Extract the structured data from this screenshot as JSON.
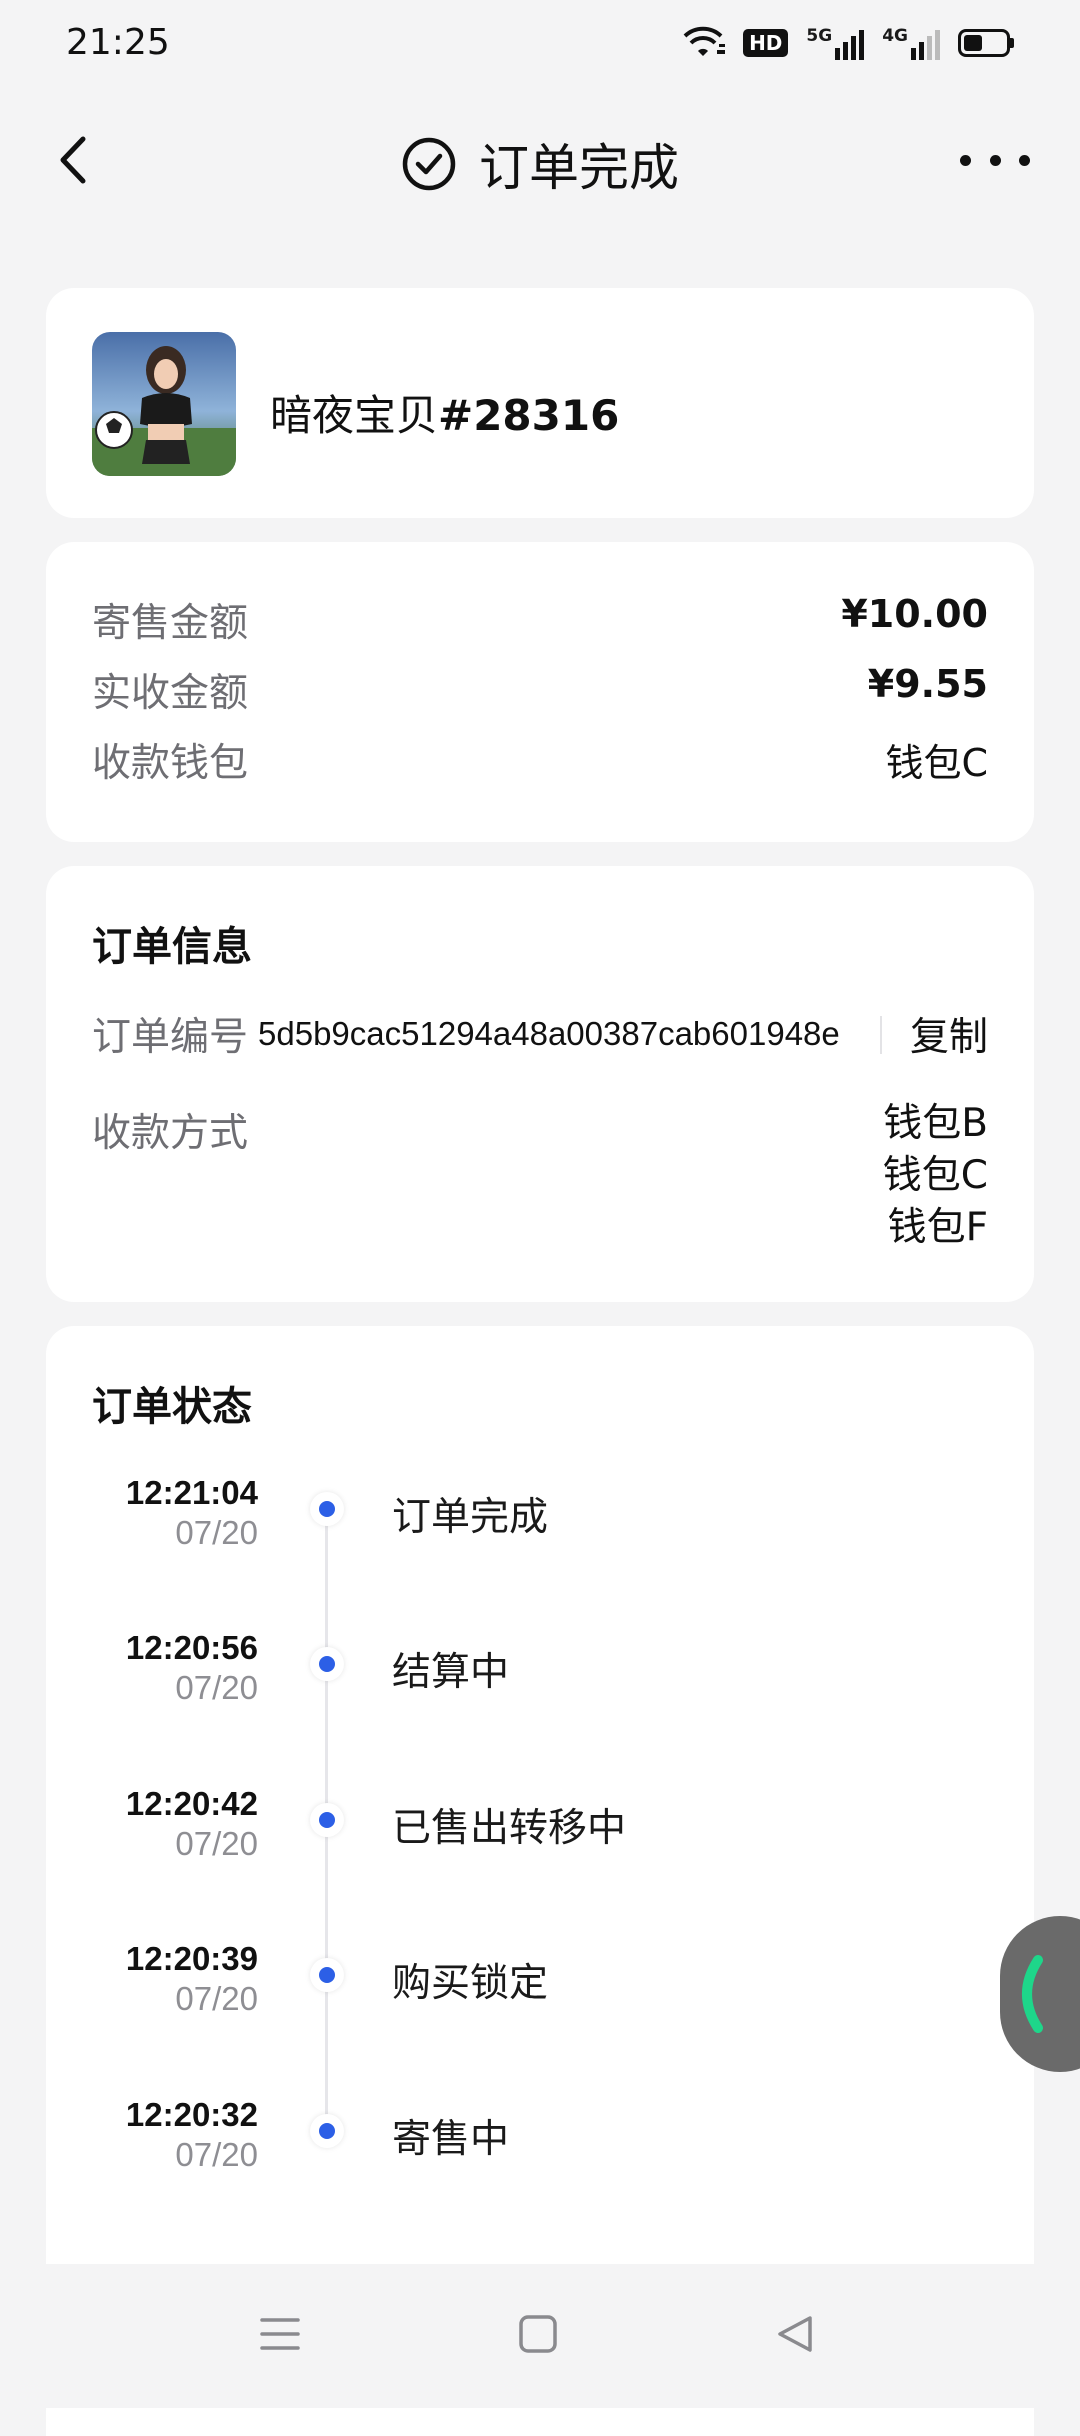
{
  "status_bar": {
    "time": "21:25",
    "hd_label": "HD",
    "sim1_label": "5G",
    "sim2_label": "4G",
    "battery_level": 0.45
  },
  "nav": {
    "back_icon": "chevron-left-icon",
    "status_icon": "check-circle-icon",
    "title": "订单完成",
    "more_icon": "more-horizontal-icon"
  },
  "product": {
    "name_prefix": "暗夜宝贝",
    "name_number": "#28316",
    "thumb_icon": "product-thumbnail"
  },
  "amounts": [
    {
      "label": "寄售金额",
      "value": "¥10.00"
    },
    {
      "label": "实收金额",
      "value": "¥9.55"
    },
    {
      "label": "收款钱包",
      "value": "钱包C"
    }
  ],
  "order_info": {
    "title": "订单信息",
    "id_label": "订单编号",
    "id_value": "5d5b9cac51294a48a00387cab601948e",
    "copy_label": "复制",
    "method_label": "收款方式",
    "methods": [
      "钱包B",
      "钱包C",
      "钱包F"
    ]
  },
  "order_status": {
    "title": "订单状态",
    "items": [
      {
        "time": "12:21:04",
        "date": "07/20",
        "label": "订单完成"
      },
      {
        "time": "12:20:56",
        "date": "07/20",
        "label": "结算中"
      },
      {
        "time": "12:20:42",
        "date": "07/20",
        "label": "已售出转移中"
      },
      {
        "time": "12:20:39",
        "date": "07/20",
        "label": "购买锁定"
      },
      {
        "time": "12:20:32",
        "date": "07/20",
        "label": "寄售中"
      }
    ]
  },
  "colors": {
    "accent_dot": "#2c5fe6",
    "page_bg": "#f4f4f5",
    "card_bg": "#ffffff"
  },
  "system_nav": {
    "menu_icon": "menu-icon",
    "home_icon": "home-square-icon",
    "back_icon": "back-triangle-icon"
  }
}
